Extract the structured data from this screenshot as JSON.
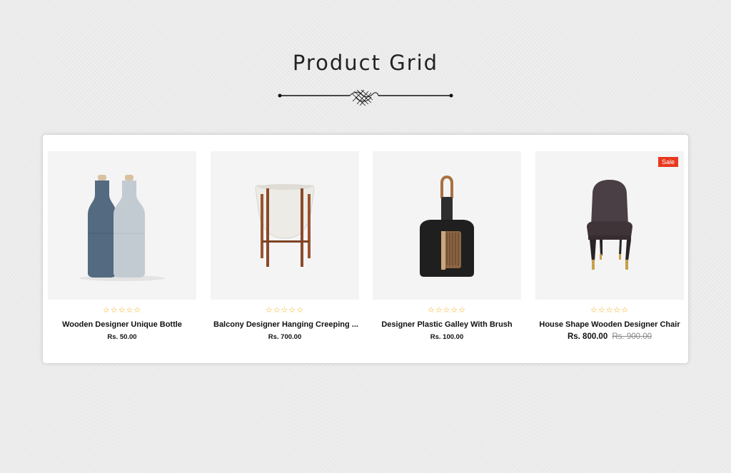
{
  "section": {
    "title": "Product Grid"
  },
  "products": [
    {
      "name": "Wooden Designer Unique Bottle",
      "rating": "☆☆☆☆☆",
      "price": "Rs. 50.00",
      "old_price": "",
      "badge": ""
    },
    {
      "name": "Balcony Designer Hanging Creeping ...",
      "rating": "☆☆☆☆☆",
      "price": "Rs. 700.00",
      "old_price": "",
      "badge": ""
    },
    {
      "name": "Designer Plastic Galley With Brush",
      "rating": "☆☆☆☆☆",
      "price": "Rs. 100.00",
      "old_price": "",
      "badge": ""
    },
    {
      "name": "House Shape Wooden Designer Chair",
      "rating": "☆☆☆☆☆",
      "price": "Rs. 800.00",
      "old_price": "Rs. 900.00",
      "badge": "Sale"
    }
  ],
  "colors": {
    "star": "#f3a80a",
    "sale_badge": "#e8381e",
    "card_bg": "#ffffff",
    "image_bg": "#f4f4f4"
  }
}
